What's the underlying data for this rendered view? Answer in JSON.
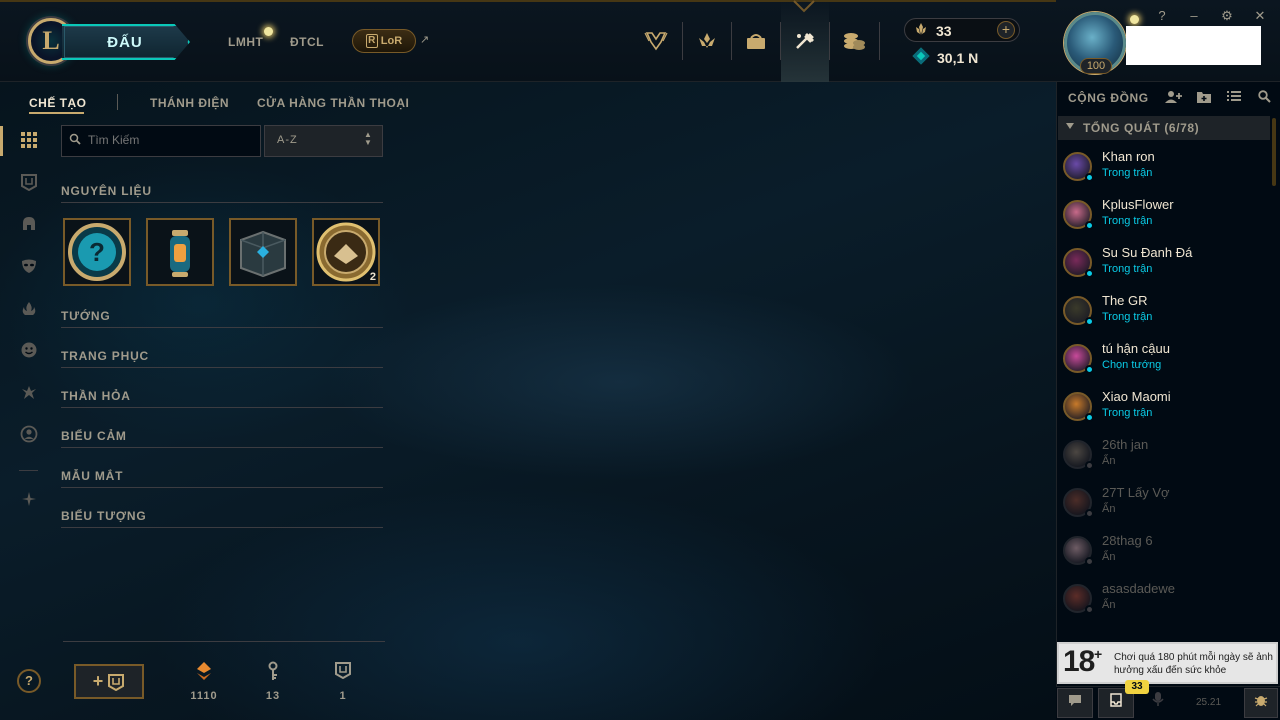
{
  "header": {
    "play_label": "ĐẤU",
    "links": [
      "LMHT",
      "ĐTCL"
    ],
    "lor_label": "LoR",
    "lor_letter": "R",
    "logo_letter": "L",
    "currency": {
      "rp": "33",
      "be": "30,1 N"
    },
    "level": "100",
    "window_controls": [
      "?",
      "–",
      "⚙",
      "✕"
    ]
  },
  "subnav": {
    "tabs": [
      "CHẾ TẠO",
      "THÁNH ĐIỆN",
      "CỬA HÀNG THẦN THOẠI"
    ],
    "active_index": 0
  },
  "crafting": {
    "search_placeholder": "Tìm Kiếm",
    "sort_value": "A-Z",
    "categories": [
      "NGUYÊN LIỆU",
      "TƯỚNG",
      "TRANG PHỤC",
      "THẦN HỎA",
      "BIỂU CẢM",
      "MẪU MẮT",
      "BIỂU TƯỢNG"
    ],
    "materials": [
      {
        "icon": "mystery-orb-icon",
        "count": ""
      },
      {
        "icon": "capsule-icon",
        "count": ""
      },
      {
        "icon": "hextech-chest-icon",
        "count": ""
      },
      {
        "icon": "token-icon",
        "count": "2"
      }
    ],
    "resources": [
      {
        "icon": "orange-essence-icon",
        "value": "1110"
      },
      {
        "icon": "key-icon",
        "value": "13"
      },
      {
        "icon": "chest-icon",
        "value": "1"
      }
    ],
    "help_label": "?",
    "craft_plus": "+"
  },
  "social": {
    "title": "CỘNG ĐỒNG",
    "group_label": "TỔNG QUÁT (6/78)",
    "friends": [
      {
        "name": "Khan ron",
        "status": "Trong trận",
        "away": false,
        "color": "#6a4aa8"
      },
      {
        "name": "KplusFlower",
        "status": "Trong trận",
        "away": false,
        "color": "#c86a8a"
      },
      {
        "name": "Su Su Đanh Đá",
        "status": "Trong trận",
        "away": false,
        "color": "#7a2a5a"
      },
      {
        "name": "The GR",
        "status": "Trong trận",
        "away": false,
        "color": "#3a3a2a"
      },
      {
        "name": "tú hận cậuu",
        "status": "Chọn tướng",
        "away": false,
        "color": "#c84a9a"
      },
      {
        "name": "Xiao Maomi",
        "status": "Trong trận",
        "away": false,
        "color": "#c87a2a"
      },
      {
        "name": "26th jan",
        "status": "Ẩn",
        "away": true,
        "color": "#8a7a6a"
      },
      {
        "name": "27T Lấy Vợ",
        "status": "Ẩn",
        "away": true,
        "color": "#8a4a3a"
      },
      {
        "name": "28thag 6",
        "status": "Ẩn",
        "away": true,
        "color": "#c8a0a8"
      },
      {
        "name": "asasdadewe",
        "status": "Ẩn",
        "away": true,
        "color": "#a84a3a"
      }
    ],
    "age_rating": "18",
    "age_plus": "+",
    "age_warning": "Chơi quá 180 phút mỗi ngày sẽ ảnh hưởng xấu đến sức khỏe",
    "notification_count": "33",
    "version": "25.21"
  },
  "colors": {
    "gold": "#c8aa6e",
    "teal": "#0ac8b9",
    "online": "#0acbe6",
    "background": "#010a13"
  }
}
